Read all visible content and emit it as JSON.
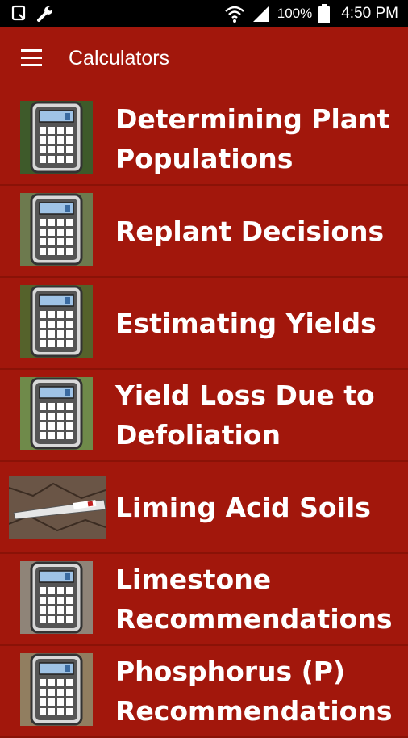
{
  "status_bar": {
    "battery": "100%",
    "time": "4:50 PM"
  },
  "app_bar": {
    "title": "Calculators"
  },
  "calculators": [
    {
      "label": "Determining Plant\nPopulations",
      "icon": "calculator-icon",
      "bg": "#3e5a2a"
    },
    {
      "label": "Replant Decisions",
      "icon": "calculator-icon",
      "bg": "#6d7a4e"
    },
    {
      "label": "Estimating Yields",
      "icon": "calculator-icon",
      "bg": "#55622b"
    },
    {
      "label": "Yield Loss Due to\nDefoliation",
      "icon": "calculator-icon",
      "bg": "#6f8a4a"
    },
    {
      "label": "Liming Acid Soils",
      "icon": "soil-thermometer-photo",
      "bg": "#6a5546"
    },
    {
      "label": "Limestone\nRecommendations",
      "icon": "calculator-icon",
      "bg": "#8f8478"
    },
    {
      "label": "Phosphorus (P)\nRecommendations",
      "icon": "calculator-icon",
      "bg": "#917e60"
    }
  ]
}
